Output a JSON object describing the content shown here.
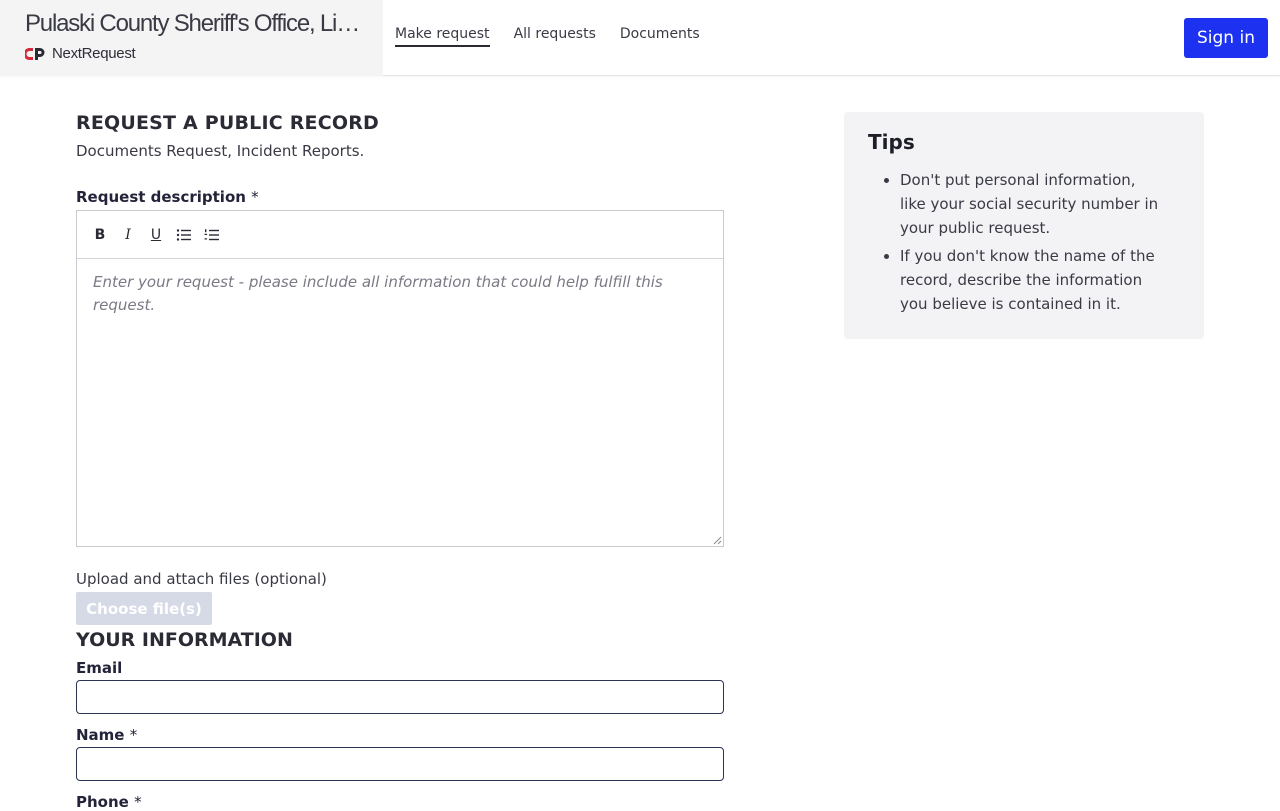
{
  "header": {
    "agency_title": "Pulaski County Sheriff's Office, Little Rock, AR",
    "brand_name": "NextRequest",
    "nav": [
      {
        "label": "Make request",
        "active": true
      },
      {
        "label": "All requests",
        "active": false
      },
      {
        "label": "Documents",
        "active": false
      }
    ],
    "sign_in_label": "Sign in"
  },
  "colors": {
    "accent": "#1d31f0",
    "brand_red": "#d42a3a",
    "tips_bg": "#f3f3f5",
    "disabled_button": "#d6d9e6"
  },
  "form": {
    "title": "REQUEST A PUBLIC RECORD",
    "subtitle": "Documents Request, Incident Reports.",
    "description_label": "Request description",
    "required_marker": "*",
    "toolbar": [
      "bold-icon",
      "italic-icon",
      "underline-icon",
      "bullet-list-icon",
      "numbered-list-icon"
    ],
    "toolbar_glyphs": {
      "bold": "B",
      "italic": "I",
      "underline": "U"
    },
    "description_placeholder": "Enter your request - please include all information that could help fulfill this request.",
    "description_value": "",
    "upload_label": "Upload and attach files (optional)",
    "choose_files_label": "Choose file(s)",
    "your_info_title": "YOUR INFORMATION",
    "email_label": "Email",
    "email_value": "",
    "name_label": "Name",
    "name_value": "",
    "phone_label": "Phone"
  },
  "tips": {
    "title": "Tips",
    "items": [
      "Don't put personal information, like your social security number in your public request.",
      "If you don't know the name of the record, describe the information you believe is contained in it."
    ]
  }
}
